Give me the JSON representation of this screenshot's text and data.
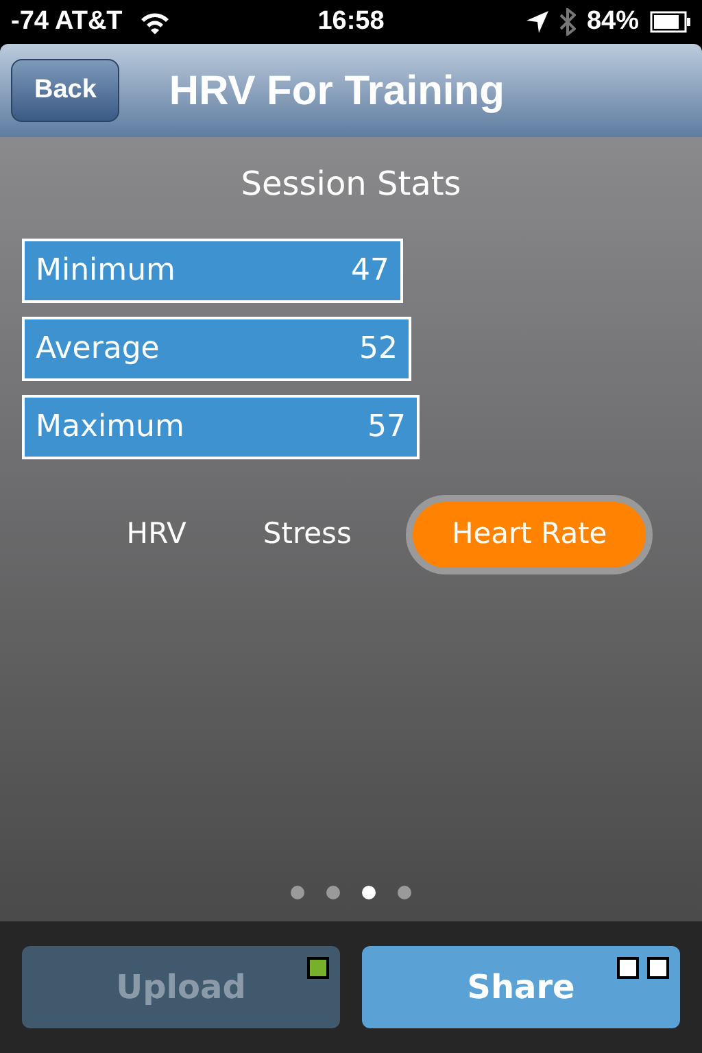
{
  "status_bar": {
    "carrier": "-74 AT&T",
    "time": "16:58",
    "battery": "84%"
  },
  "nav_bar": {
    "back": "Back",
    "title": "HRV For Training"
  },
  "section_title": "Session Stats",
  "stats": [
    {
      "label": "Minimum",
      "value": "47"
    },
    {
      "label": "Average",
      "value": "52"
    },
    {
      "label": "Maximum",
      "value": "57"
    }
  ],
  "tabs": [
    {
      "label": "HRV",
      "selected": false
    },
    {
      "label": "Stress",
      "selected": false
    },
    {
      "label": "Heart Rate",
      "selected": true
    }
  ],
  "pages": [
    {
      "selected": false
    },
    {
      "selected": false
    },
    {
      "selected": true
    },
    {
      "selected": false
    }
  ],
  "buttons": [
    {
      "label": "Upload",
      "disabled": true,
      "indicators": [
        {
          "color": "#77b02a"
        }
      ]
    },
    {
      "label": "Share",
      "disabled": false,
      "indicators": [
        {
          "color": "#ffffff"
        },
        {
          "color": "#ffffff"
        }
      ]
    }
  ]
}
